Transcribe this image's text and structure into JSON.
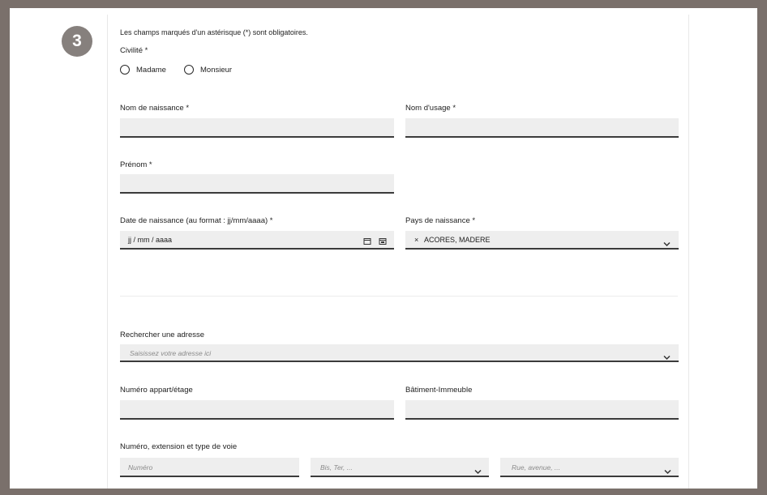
{
  "step": {
    "number": "3"
  },
  "form": {
    "required_note": "Les champs marqués d'un astérisque (*) sont obligatoires.",
    "civilite": {
      "label": "Civilité *",
      "options": [
        "Madame",
        "Monsieur"
      ]
    },
    "nom_naissance": {
      "label": "Nom de naissance *",
      "value": ""
    },
    "nom_usage": {
      "label": "Nom d'usage *",
      "value": ""
    },
    "prenom": {
      "label": "Prénom *",
      "value": ""
    },
    "date_naissance": {
      "label": "Date de naissance (au format : jj/mm/aaaa) *",
      "placeholder": "jj / mm / aaaa"
    },
    "pays_naissance": {
      "label": "Pays de naissance *",
      "clear": "×",
      "value": "ACORES, MADERE"
    },
    "adresse": {
      "label": "Rechercher une adresse",
      "placeholder": "Saisissez votre adresse ici"
    },
    "appart": {
      "label": "Numéro appart/étage",
      "value": ""
    },
    "batiment": {
      "label": "Bâtiment-Immeuble",
      "value": ""
    },
    "voie": {
      "label": "Numéro, extension et type de voie",
      "numero_placeholder": "Numéro",
      "extension_placeholder": "Bis, Ter, ...",
      "type_placeholder": "Rue, avenue, ..."
    }
  },
  "icons": {
    "chevron": "chevron-down-icon",
    "calendar": "calendar-icon"
  }
}
